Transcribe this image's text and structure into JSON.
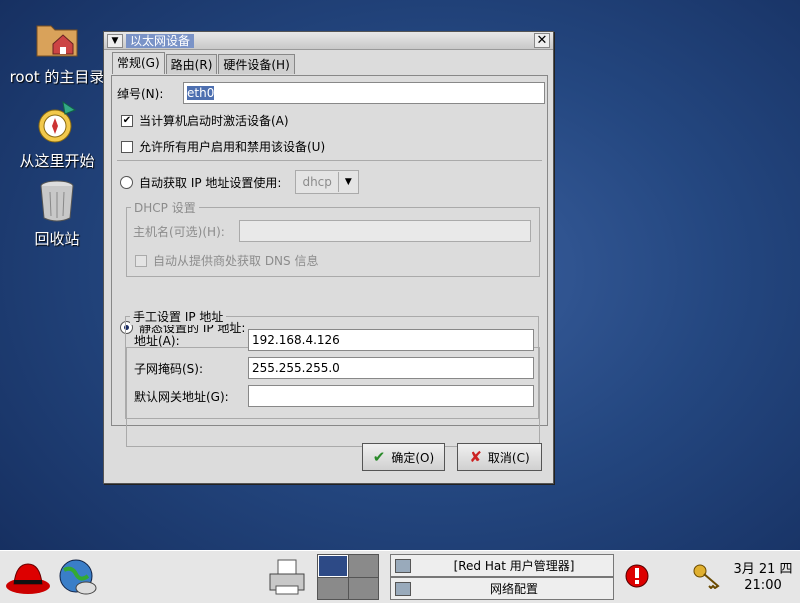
{
  "desktop": {
    "icons": [
      {
        "label": "root 的主目录"
      },
      {
        "label": "从这里开始"
      },
      {
        "label": "回收站"
      }
    ]
  },
  "dialog": {
    "title": "以太网设备",
    "tabs": [
      "常规(G)",
      "路由(R)",
      "硬件设备(H)"
    ],
    "nickname_label": "绰号(N):",
    "nickname_value": "eth0",
    "check_activate_label": "当计算机启动时激活设备(A)",
    "check_activate_checked": true,
    "check_allow_users_label": "允许所有用户启用和禁用该设备(U)",
    "check_allow_users_checked": false,
    "radio_auto_label": "自动获取 IP 地址设置使用:",
    "auto_method_value": "dhcp",
    "dhcp_group_title": "DHCP 设置",
    "hostname_label": "主机名(可选)(H):",
    "hostname_value": "",
    "auto_dns_label": "自动从提供商处获取 DNS 信息",
    "radio_static_label": "静态设置的 IP 地址:",
    "static_selected": true,
    "manual_group_title": "手工设置 IP 地址",
    "address_label": "地址(A):",
    "address_value": "192.168.4.126",
    "netmask_label": "子网掩码(S):",
    "netmask_value": "255.255.255.0",
    "gateway_label": "默认网关地址(G):",
    "gateway_value": "",
    "ok_label": "确定(O)",
    "cancel_label": "取消(C)"
  },
  "taskbar": {
    "tasks": [
      "[Red Hat 用户管理器]",
      "网络配置"
    ],
    "clock_date": "3月 21 四",
    "clock_time": "21:00"
  },
  "colors": {
    "desktop_bg": "#244780",
    "selection": "#4d6fb0",
    "window_bg": "#dcdcdc"
  }
}
